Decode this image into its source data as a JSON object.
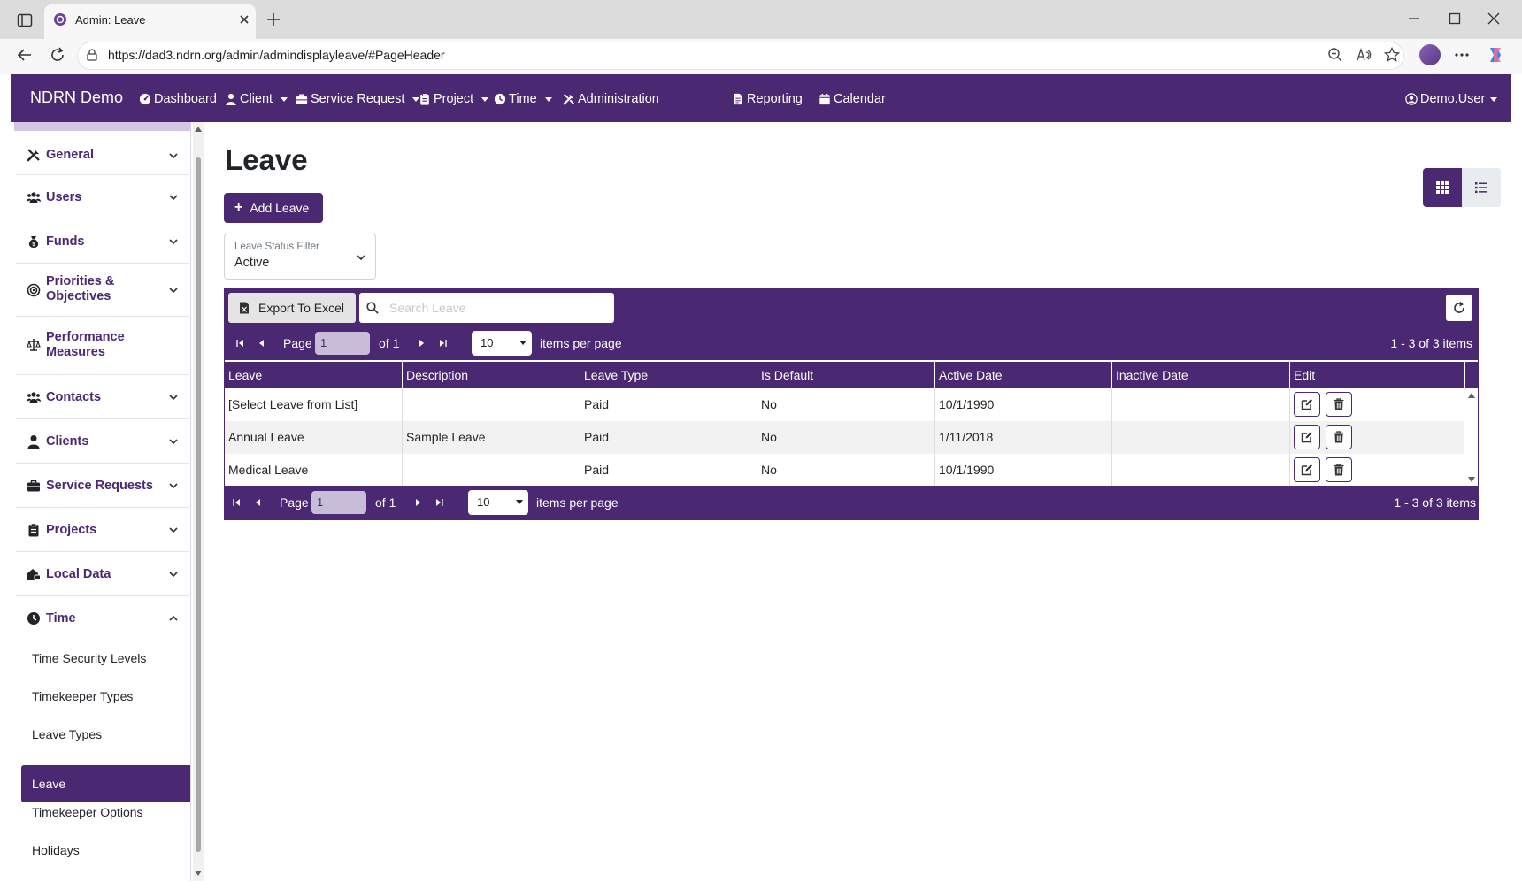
{
  "browser": {
    "tab_title": "Admin: Leave",
    "url": "https://dad3.ndrn.org/admin/admindisplayleave/#PageHeader"
  },
  "app": {
    "brand": "NDRN Demo",
    "nav": {
      "dashboard": "Dashboard",
      "client": "Client",
      "service_request": "Service Request",
      "project": "Project",
      "time": "Time",
      "administration": "Administration",
      "reporting": "Reporting",
      "calendar": "Calendar",
      "user": "Demo.User"
    },
    "colors": {
      "primary": "#4a2872",
      "sidebar_accent": "#d4c6e6"
    }
  },
  "sidebar": {
    "general": "General",
    "users": "Users",
    "funds": "Funds",
    "priorities": "Priorities &",
    "priorities_2": "Objectives",
    "performance": "Performance",
    "performance_2": "Measures",
    "contacts": "Contacts",
    "clients": "Clients",
    "service_requests": "Service Requests",
    "projects": "Projects",
    "local_data": "Local Data",
    "time": "Time",
    "time_children": {
      "security_levels": "Time Security Levels",
      "timekeeper_types": "Timekeeper Types",
      "leave_types": "Leave Types",
      "leave": "Leave",
      "timekeeper_options": "Timekeeper Options",
      "holidays": "Holidays"
    }
  },
  "main": {
    "title": "Leave",
    "add_button": "Add Leave",
    "filter": {
      "label": "Leave Status Filter",
      "value": "Active"
    },
    "grid": {
      "export_button": "Export To Excel",
      "search_placeholder": "Search Leave",
      "pager": {
        "page_label": "Page",
        "page_value": "1",
        "of_label": "of 1",
        "page_size": "10",
        "items_per_page": "items per page",
        "info": "1 - 3 of 3 items"
      },
      "columns": {
        "leave": "Leave",
        "description": "Description",
        "leave_type": "Leave Type",
        "is_default": "Is Default",
        "active_date": "Active Date",
        "inactive_date": "Inactive Date",
        "edit": "Edit"
      },
      "rows": [
        {
          "leave": "[Select Leave from List]",
          "description": "",
          "leave_type": "Paid",
          "is_default": "No",
          "active_date": "10/1/1990",
          "inactive_date": ""
        },
        {
          "leave": "Annual Leave",
          "description": "Sample Leave",
          "leave_type": "Paid",
          "is_default": "No",
          "active_date": "1/11/2018",
          "inactive_date": ""
        },
        {
          "leave": "Medical Leave",
          "description": "",
          "leave_type": "Paid",
          "is_default": "No",
          "active_date": "10/1/1990",
          "inactive_date": ""
        }
      ]
    }
  }
}
